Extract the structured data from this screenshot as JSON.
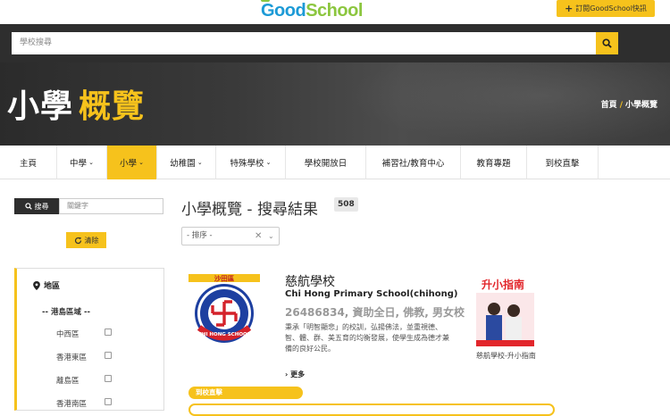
{
  "topbar": {
    "logo_part1": "Good",
    "logo_part2": "School",
    "subscribe_label": "訂閱GoodSchool快訊"
  },
  "search": {
    "placeholder": "學校搜尋"
  },
  "banner": {
    "title_main": "小學",
    "title_accent": "概覽",
    "breadcrumb": [
      "首頁",
      "小學概覽"
    ]
  },
  "nav": {
    "items": [
      {
        "label": "主頁",
        "has_dropdown": false
      },
      {
        "label": "中學",
        "has_dropdown": true
      },
      {
        "label": "小學",
        "has_dropdown": true,
        "active": true
      },
      {
        "label": "幼稚園",
        "has_dropdown": true
      },
      {
        "label": "特殊學校",
        "has_dropdown": true
      },
      {
        "label": "學校開放日",
        "has_dropdown": false
      },
      {
        "label": "補習社/教育中心",
        "has_dropdown": false
      },
      {
        "label": "教育專題",
        "has_dropdown": false
      },
      {
        "label": "到校直擊",
        "has_dropdown": false
      }
    ]
  },
  "sidebar": {
    "search_button": "搜尋",
    "keyword_placeholder": "關鍵字",
    "clear_button": "清除",
    "filter": {
      "title": "地區",
      "group": "-- 港島區域 --",
      "districts": [
        "中西區",
        "香港東區",
        "離島區",
        "香港南區"
      ]
    }
  },
  "main": {
    "title": "小學概覽 - 搜尋結果",
    "count": "508",
    "sort_placeholder": "- 排序 -",
    "school": {
      "district_badge": "沙田區",
      "logo_text": "CHI HONG SCHOOL",
      "name_zh": "慈航學校",
      "name_en": "Chi Hong Primary School(chihong)",
      "info": "26486834, 資助全日, 佛教, 男女校",
      "description": "秉承「明智顯悲」的校訓，弘揚佛法，並重視德、智、體、群、美五育的均衡發展，使學生成為德才兼備的良好公民。",
      "more": "更多",
      "guide_caption": "慈航學校-升小指南",
      "guide_title": "升小指南"
    },
    "visit_tab": "到校直擊"
  },
  "colors": {
    "accent": "#f6c21c",
    "dark": "#2e2e2e",
    "logo_blue": "#1c9ad6",
    "logo_green": "#8cc63f"
  }
}
